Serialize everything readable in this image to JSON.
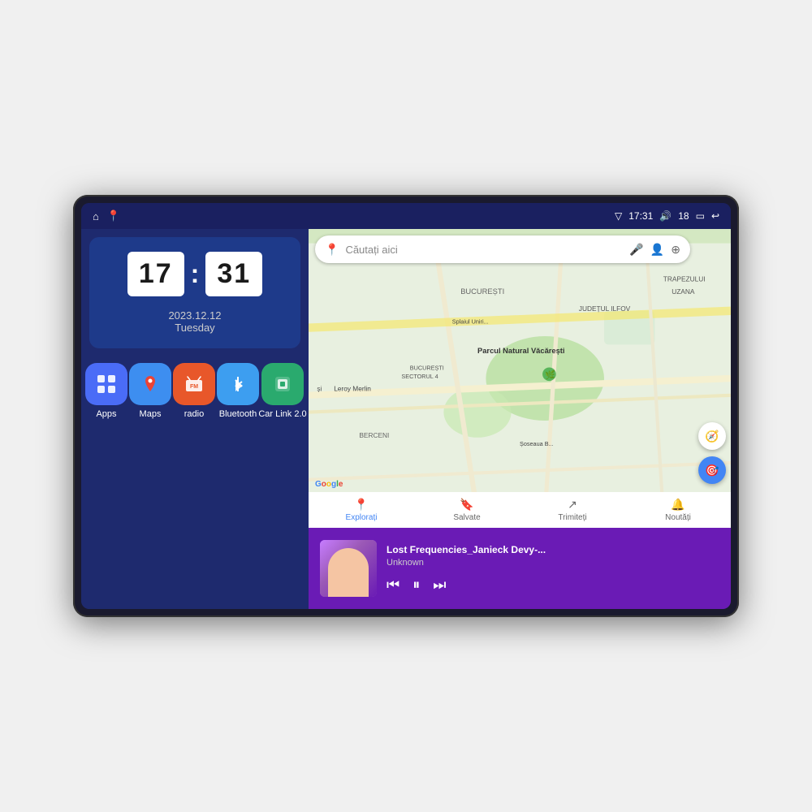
{
  "device": {
    "status_bar": {
      "left_icons": [
        "⌂",
        "📍"
      ],
      "time": "17:31",
      "signal_icon": "▽",
      "volume_icon": "🔊",
      "volume_level": "18",
      "battery_icon": "▭",
      "back_icon": "↩"
    },
    "clock_widget": {
      "hour": "17",
      "minute": "31",
      "date": "2023.12.12",
      "day": "Tuesday"
    },
    "app_icons": [
      {
        "id": "apps",
        "label": "Apps",
        "icon": "⊞",
        "color_class": "icon-apps"
      },
      {
        "id": "maps",
        "label": "Maps",
        "icon": "📍",
        "color_class": "icon-maps"
      },
      {
        "id": "radio",
        "label": "radio",
        "icon": "📻",
        "color_class": "icon-radio"
      },
      {
        "id": "bluetooth",
        "label": "Bluetooth",
        "icon": "🔷",
        "color_class": "icon-bluetooth"
      },
      {
        "id": "carlink",
        "label": "Car Link 2.0",
        "icon": "📱",
        "color_class": "icon-carlink"
      }
    ],
    "map": {
      "search_placeholder": "Căutați aici",
      "nav_items": [
        {
          "id": "explore",
          "label": "Explorați",
          "icon": "📍"
        },
        {
          "id": "saved",
          "label": "Salvate",
          "icon": "🔖"
        },
        {
          "id": "share",
          "label": "Trimiteți",
          "icon": "↗"
        },
        {
          "id": "news",
          "label": "Noutăți",
          "icon": "🔔"
        }
      ],
      "google_text": "Google"
    },
    "music": {
      "title": "Lost Frequencies_Janieck Devy-...",
      "artist": "Unknown",
      "prev_icon": "⏮",
      "play_pause_icon": "⏸",
      "next_icon": "⏭"
    }
  }
}
